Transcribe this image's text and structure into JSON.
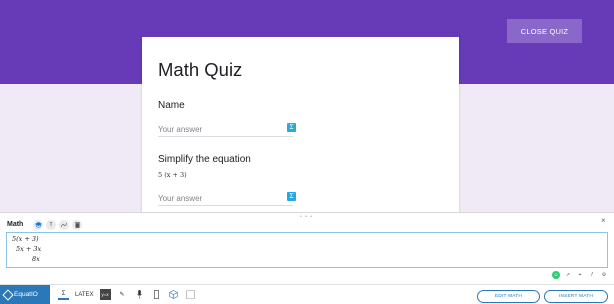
{
  "header": {
    "close_label": "CLOSE QUIZ"
  },
  "form": {
    "title": "Math Quiz",
    "questions": [
      {
        "label": "Name",
        "placeholder": "Your answer"
      },
      {
        "label": "Simplify the equation",
        "equation": "5 (x + 3)",
        "placeholder": "Your answer"
      }
    ],
    "sigma_icon": "Σ"
  },
  "editor": {
    "grip": "• • •",
    "close": "×",
    "title": "Math",
    "modes": [
      "mode-graduation-icon",
      "mode-text-icon",
      "mode-handwriting-icon",
      "mode-delete-icon"
    ],
    "lines": [
      "5(x + 3)",
      "5x + 3x",
      "8x"
    ],
    "accent_color": "#2a78b8"
  },
  "toolbar": {
    "brand": "EquatIO",
    "latex_label": "LATEX",
    "edit_label": "EDIT MATH",
    "insert_label": "INSERT MATH"
  }
}
